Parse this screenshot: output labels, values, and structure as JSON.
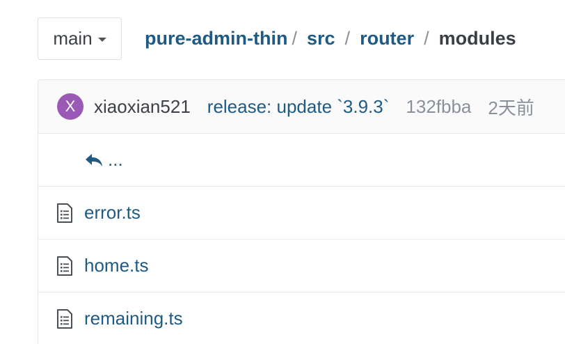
{
  "branch": {
    "label": "main",
    "icon": "caret-down-icon"
  },
  "breadcrumb": {
    "items": [
      "pure-admin-thin",
      "src",
      "router"
    ],
    "separator": "/",
    "current": "modules"
  },
  "last_commit": {
    "avatar_letter": "X",
    "avatar_color": "#9b59b6",
    "author": "xiaoxian521",
    "message": "release: update `3.9.3`",
    "sha": "132fbba",
    "time": "2天前"
  },
  "tree": {
    "parent_label": "...",
    "parent_icon": "reply-arrow-icon",
    "files": [
      {
        "name": "error.ts",
        "icon": "file-text-icon"
      },
      {
        "name": "home.ts",
        "icon": "file-text-icon"
      },
      {
        "name": "remaining.ts",
        "icon": "file-text-icon"
      }
    ]
  },
  "colors": {
    "link": "#1f5a82",
    "muted": "#8a9099",
    "text": "#3d4147"
  }
}
